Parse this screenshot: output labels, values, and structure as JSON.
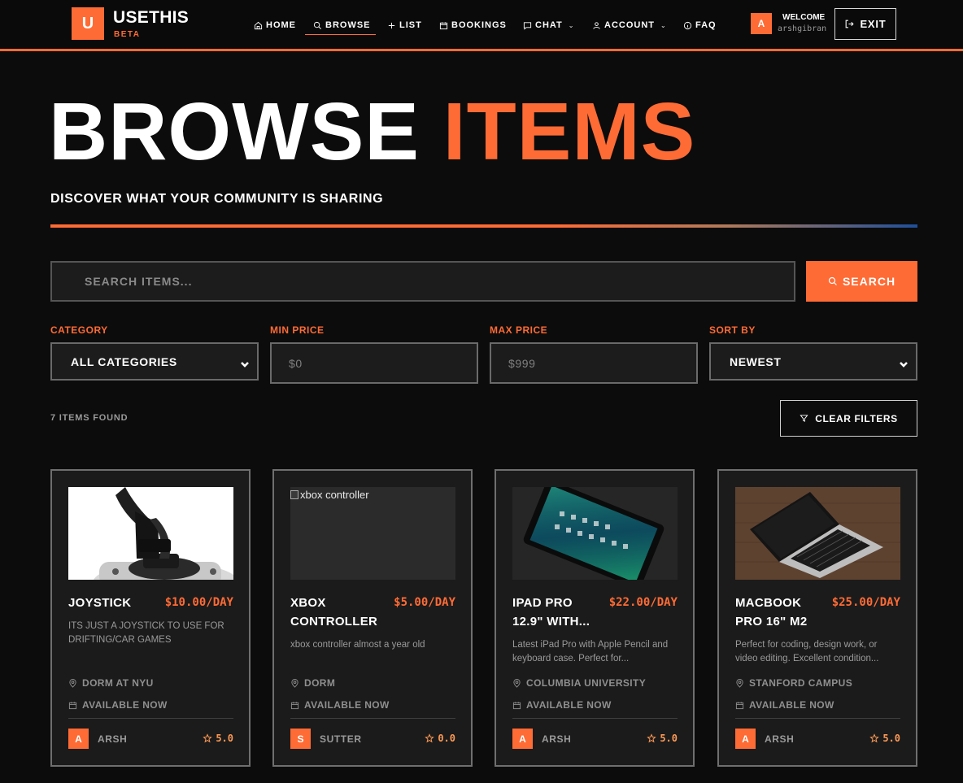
{
  "brand": {
    "logo_letter": "U",
    "name": "USETHIS",
    "tag": "BETA",
    "accent": "#ff6b35"
  },
  "nav": {
    "items": [
      {
        "label": "HOME",
        "icon": "home-icon"
      },
      {
        "label": "BROWSE",
        "icon": "search-icon",
        "active": true
      },
      {
        "label": "LIST",
        "icon": "plus-icon"
      },
      {
        "label": "BOOKINGS",
        "icon": "calendar-icon"
      },
      {
        "label": "CHAT",
        "icon": "chat-icon",
        "dropdown": true
      },
      {
        "label": "ACCOUNT",
        "icon": "user-icon",
        "dropdown": true
      },
      {
        "label": "FAQ",
        "icon": "info-icon"
      }
    ]
  },
  "user": {
    "avatar_letter": "A",
    "welcome": "WELCOME",
    "username": "arshgibran",
    "exit_label": "EXIT"
  },
  "hero": {
    "title_main": "BROWSE",
    "title_accent": "ITEMS",
    "subtitle": "DISCOVER WHAT YOUR COMMUNITY IS SHARING"
  },
  "search": {
    "placeholder": "SEARCH ITEMS...",
    "button_label": "SEARCH"
  },
  "filters": {
    "category": {
      "label": "CATEGORY",
      "value": "ALL CATEGORIES"
    },
    "min_price": {
      "label": "MIN PRICE",
      "placeholder": "$0"
    },
    "max_price": {
      "label": "MAX PRICE",
      "placeholder": "$999"
    },
    "sort": {
      "label": "SORT BY",
      "value": "NEWEST"
    }
  },
  "results": {
    "count_text": "7 ITEMS FOUND",
    "clear_label": "CLEAR FILTERS"
  },
  "items": [
    {
      "title": "JOYSTICK",
      "price": "$10.00/DAY",
      "description": "ITS JUST A JOYSTICK TO USE FOR DRIFTING/CAR GAMES",
      "location": "DORM AT NYU",
      "availability": "AVAILABLE NOW",
      "owner_letter": "A",
      "owner": "ARSH",
      "rating": "5.0"
    },
    {
      "title": "XBOX CONTROLLER",
      "price": "$5.00/DAY",
      "description": "xbox controller almost a year old",
      "image_alt": "xbox controller",
      "location": "DORM",
      "availability": "AVAILABLE NOW",
      "owner_letter": "S",
      "owner": "SUTTER",
      "rating": "0.0"
    },
    {
      "title": "IPAD PRO 12.9\" WITH...",
      "price": "$22.00/DAY",
      "description": "Latest iPad Pro with Apple Pencil and keyboard case. Perfect for...",
      "location": "COLUMBIA UNIVERSITY",
      "availability": "AVAILABLE NOW",
      "owner_letter": "A",
      "owner": "ARSH",
      "rating": "5.0"
    },
    {
      "title": "MACBOOK PRO 16\" M2",
      "price": "$25.00/DAY",
      "description": "Perfect for coding, design work, or video editing. Excellent condition...",
      "location": "STANFORD CAMPUS",
      "availability": "AVAILABLE NOW",
      "owner_letter": "A",
      "owner": "ARSH",
      "rating": "5.0"
    }
  ]
}
